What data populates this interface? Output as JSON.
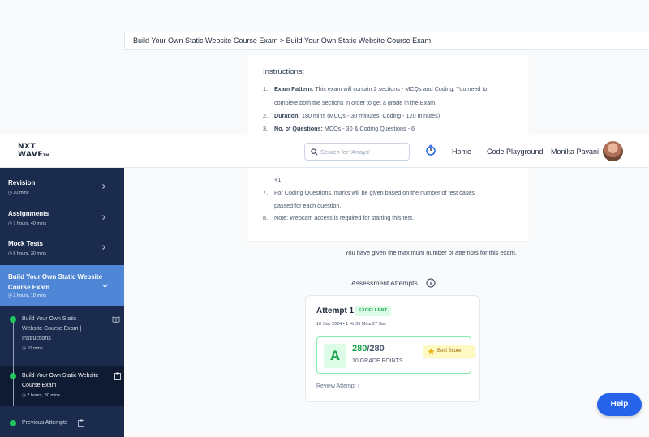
{
  "breadcrumb": "Build Your Own Static Website Course Exam > Build Your Own Static Website Course Exam",
  "instructions": {
    "title": "Instructions:",
    "lines": [
      {
        "num": "1.",
        "bold": "Exam Pattern:",
        "text": " This exam will contain 2 sections - MCQs and Coding. You need to"
      },
      {
        "num": "",
        "bold": "",
        "text": "complete both the sections in order to get a grade in the Exam."
      },
      {
        "num": "2.",
        "bold": "Duration:",
        "text": " 180 mins (MCQs - 30 minutes, Coding - 120 minutes)"
      },
      {
        "num": "3.",
        "bold": "No. of Questions:",
        "text": " MCQs - 30 & Coding Questions - 6"
      },
      {
        "num": "",
        "bold": "",
        "text": "+1"
      },
      {
        "num": "7.",
        "bold": "",
        "text": "For Coding Questions, marks will be given based on the number of test cases"
      },
      {
        "num": "",
        "bold": "",
        "text": "passed for each question."
      },
      {
        "num": "8.",
        "bold": "",
        "text": "Note: Webcam access is required for starting this test."
      }
    ]
  },
  "navbar": {
    "logo_line1": "NXT",
    "logo_line2": "WAVE",
    "logo_tm": "TM",
    "search_placeholder": "Search for 'Arrays'",
    "home": "Home",
    "playground": "Code Playground",
    "user": "Monika Pavani"
  },
  "sidebar": {
    "items": [
      {
        "title": "Revision",
        "duration": "30 mins"
      },
      {
        "title": "Assignments",
        "duration": "7 hours, 40 mins"
      },
      {
        "title": "Mock Tests",
        "duration": "6 hours, 30 mins"
      }
    ],
    "active": {
      "line1": "Build Your Own Static Website",
      "line2": "Course Exam",
      "duration": "2 hours, 10 mins"
    },
    "sub_items": [
      {
        "l1": "Build Your Own Static",
        "l2": "Website Course Exam |",
        "l3": "Instructions",
        "duration": "10 mins"
      },
      {
        "l1": "Build Your Own Static Website",
        "l2": "Course Exam",
        "duration": "2 hours, 30 mins"
      },
      {
        "l1": "Previous Attempts"
      }
    ]
  },
  "notice": "You have given the maximum number of attempts for this exam.",
  "assessment": {
    "heading": "Assessment Attempts",
    "attempt_title": "Attempt 1",
    "badge": "EXCELLENT",
    "date": "16 Sep 2024 • 1 Hr 39 Mins 27 Sec",
    "grade": "A",
    "score": "280",
    "score_total": "/280",
    "grade_points": "10 GRADE POINTS",
    "best_score": "Best Score",
    "review": "Review Attempt"
  },
  "help": "Help",
  "colors": {
    "sidebar_bg": "#1b2b4e",
    "active_bg": "#4f87d6",
    "success": "#16a34a",
    "help_bg": "#2563eb"
  }
}
